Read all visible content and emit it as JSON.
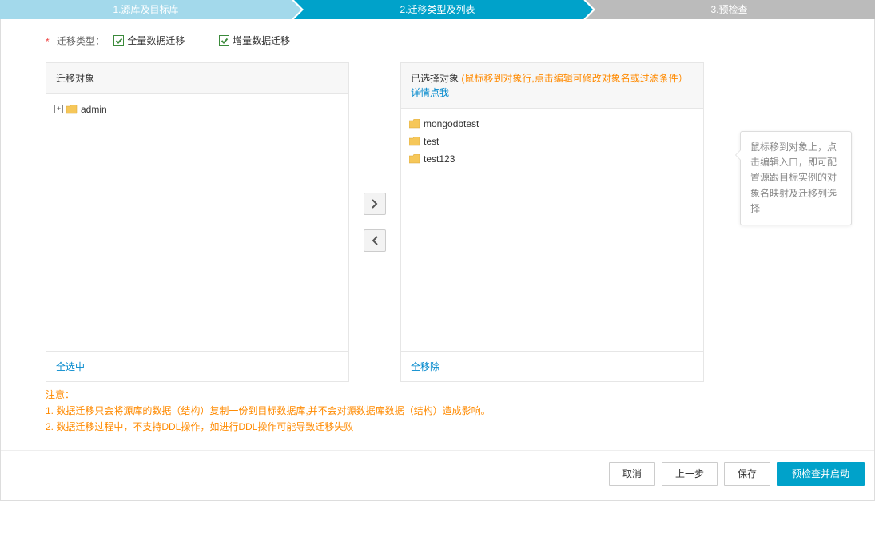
{
  "steps": {
    "s1": "1.源库及目标库",
    "s2": "2.迁移类型及列表",
    "s3": "3.预检查"
  },
  "migrationType": {
    "label": "迁移类型：",
    "full": "全量数据迁移",
    "incremental": "增量数据迁移"
  },
  "leftPanel": {
    "title": "迁移对象",
    "selectAll": "全选中",
    "root": "admin"
  },
  "rightPanel": {
    "titlePrefix": "已选择对象",
    "hint": "(鼠标移到对象行,点击编辑可修改对象名或过滤条件）",
    "detailLink": "详情点我",
    "removeAll": "全移除",
    "items": [
      "mongodbtest",
      "test",
      "test123"
    ]
  },
  "tooltip": "鼠标移到对象上，点击编辑入口，即可配置源跟目标实例的对象名映射及迁移列选择",
  "notes": {
    "header": "注意：",
    "n1": "1. 数据迁移只会将源库的数据（结构）复制一份到目标数据库,并不会对源数据库数据（结构）造成影响。",
    "n2": "2. 数据迁移过程中，不支持DDL操作，如进行DDL操作可能导致迁移失败"
  },
  "footer": {
    "cancel": "取消",
    "prev": "上一步",
    "save": "保存",
    "precheck": "预检查并启动"
  }
}
